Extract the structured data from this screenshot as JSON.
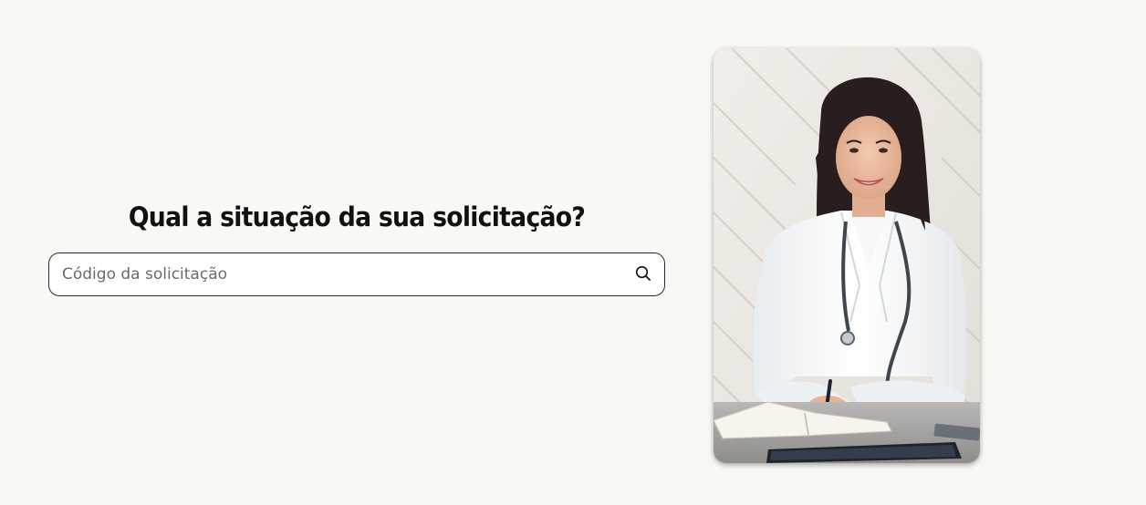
{
  "main": {
    "title": "Qual a situação da sua solicitação?",
    "search": {
      "placeholder": "Código da solicitação",
      "value": "",
      "button_icon": "search-icon"
    }
  },
  "hero_image": {
    "icon": "doctor-photo"
  },
  "colors": {
    "background": "#f9f8f5",
    "input_border": "#2b2b2b",
    "title": "#111111"
  }
}
